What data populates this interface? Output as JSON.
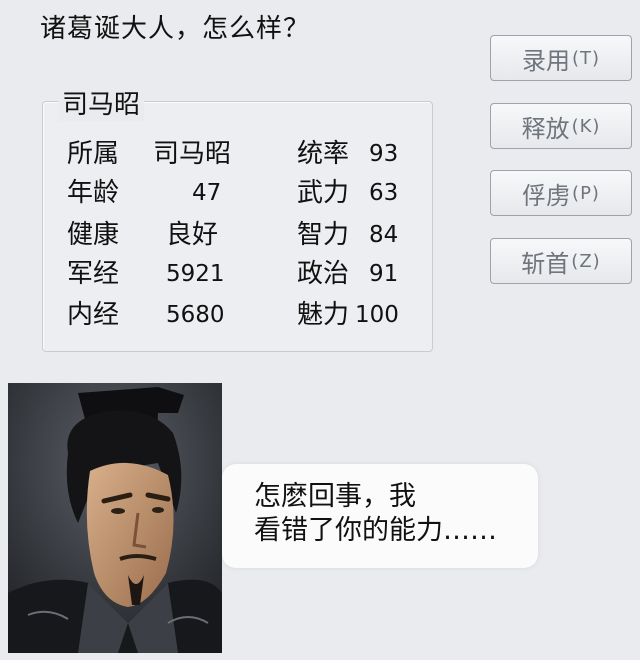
{
  "dialog": {
    "prompt": "诸葛诞大人，怎么样？"
  },
  "officer": {
    "name": "司马昭",
    "stats_left": [
      {
        "label": "所属",
        "value": "司马昭"
      },
      {
        "label": "年龄",
        "value": "47"
      },
      {
        "label": "健康",
        "value": "良好"
      },
      {
        "label": "军经",
        "value": "5921"
      },
      {
        "label": "内经",
        "value": "5680"
      }
    ],
    "stats_right": [
      {
        "label": "统率",
        "value": "93"
      },
      {
        "label": "武力",
        "value": "63"
      },
      {
        "label": "智力",
        "value": "84"
      },
      {
        "label": "政治",
        "value": "91"
      },
      {
        "label": "魅力",
        "value": "100"
      }
    ]
  },
  "actions": [
    {
      "label": "录用",
      "key": "(T)"
    },
    {
      "label": "释放",
      "key": "(K)"
    },
    {
      "label": "俘虏",
      "key": "(P)"
    },
    {
      "label": "斩首",
      "key": "(Z)"
    }
  ],
  "speech": {
    "line1": "怎麽回事，我",
    "line2": "看错了你的能力……"
  }
}
